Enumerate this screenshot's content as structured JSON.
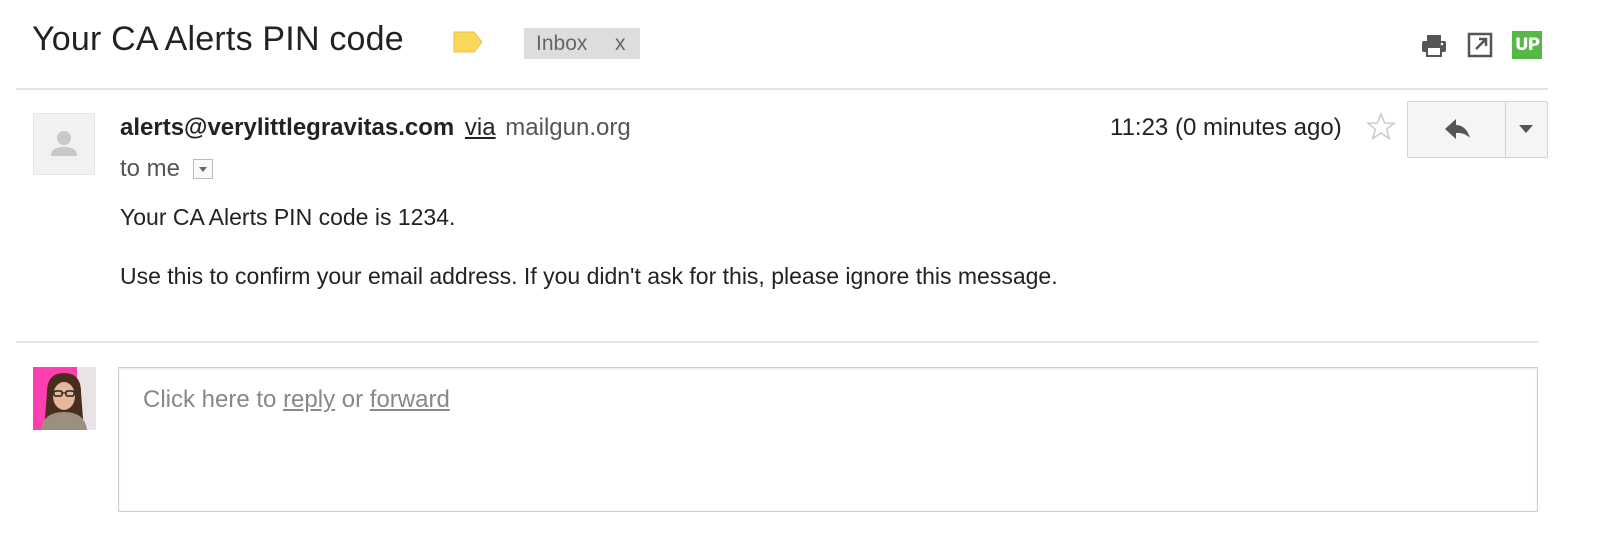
{
  "subject": "Your CA Alerts PIN code",
  "labels": {
    "inbox": "Inbox",
    "remove": "x",
    "label_color": "#f9d85b"
  },
  "toolbar": {
    "print_icon": "print-icon",
    "popout_icon": "new-window-icon",
    "extension": "UP"
  },
  "message": {
    "sender_email": "alerts@verylittlegravitas.com",
    "via_text": "via",
    "via_domain": "mailgun.org",
    "to_text": "to me",
    "timestamp": "11:23 (0 minutes ago)",
    "body": [
      "Your CA Alerts PIN code is 1234.",
      "Use this to confirm your email address. If you didn't ask for this, please ignore this message."
    ]
  },
  "reply": {
    "prompt_start": "Click here to ",
    "reply_link": "reply",
    "or_text": " or ",
    "forward_link": "forward"
  },
  "colors": {
    "extension_green": "#56b947",
    "chip_gray": "#dddddd"
  }
}
